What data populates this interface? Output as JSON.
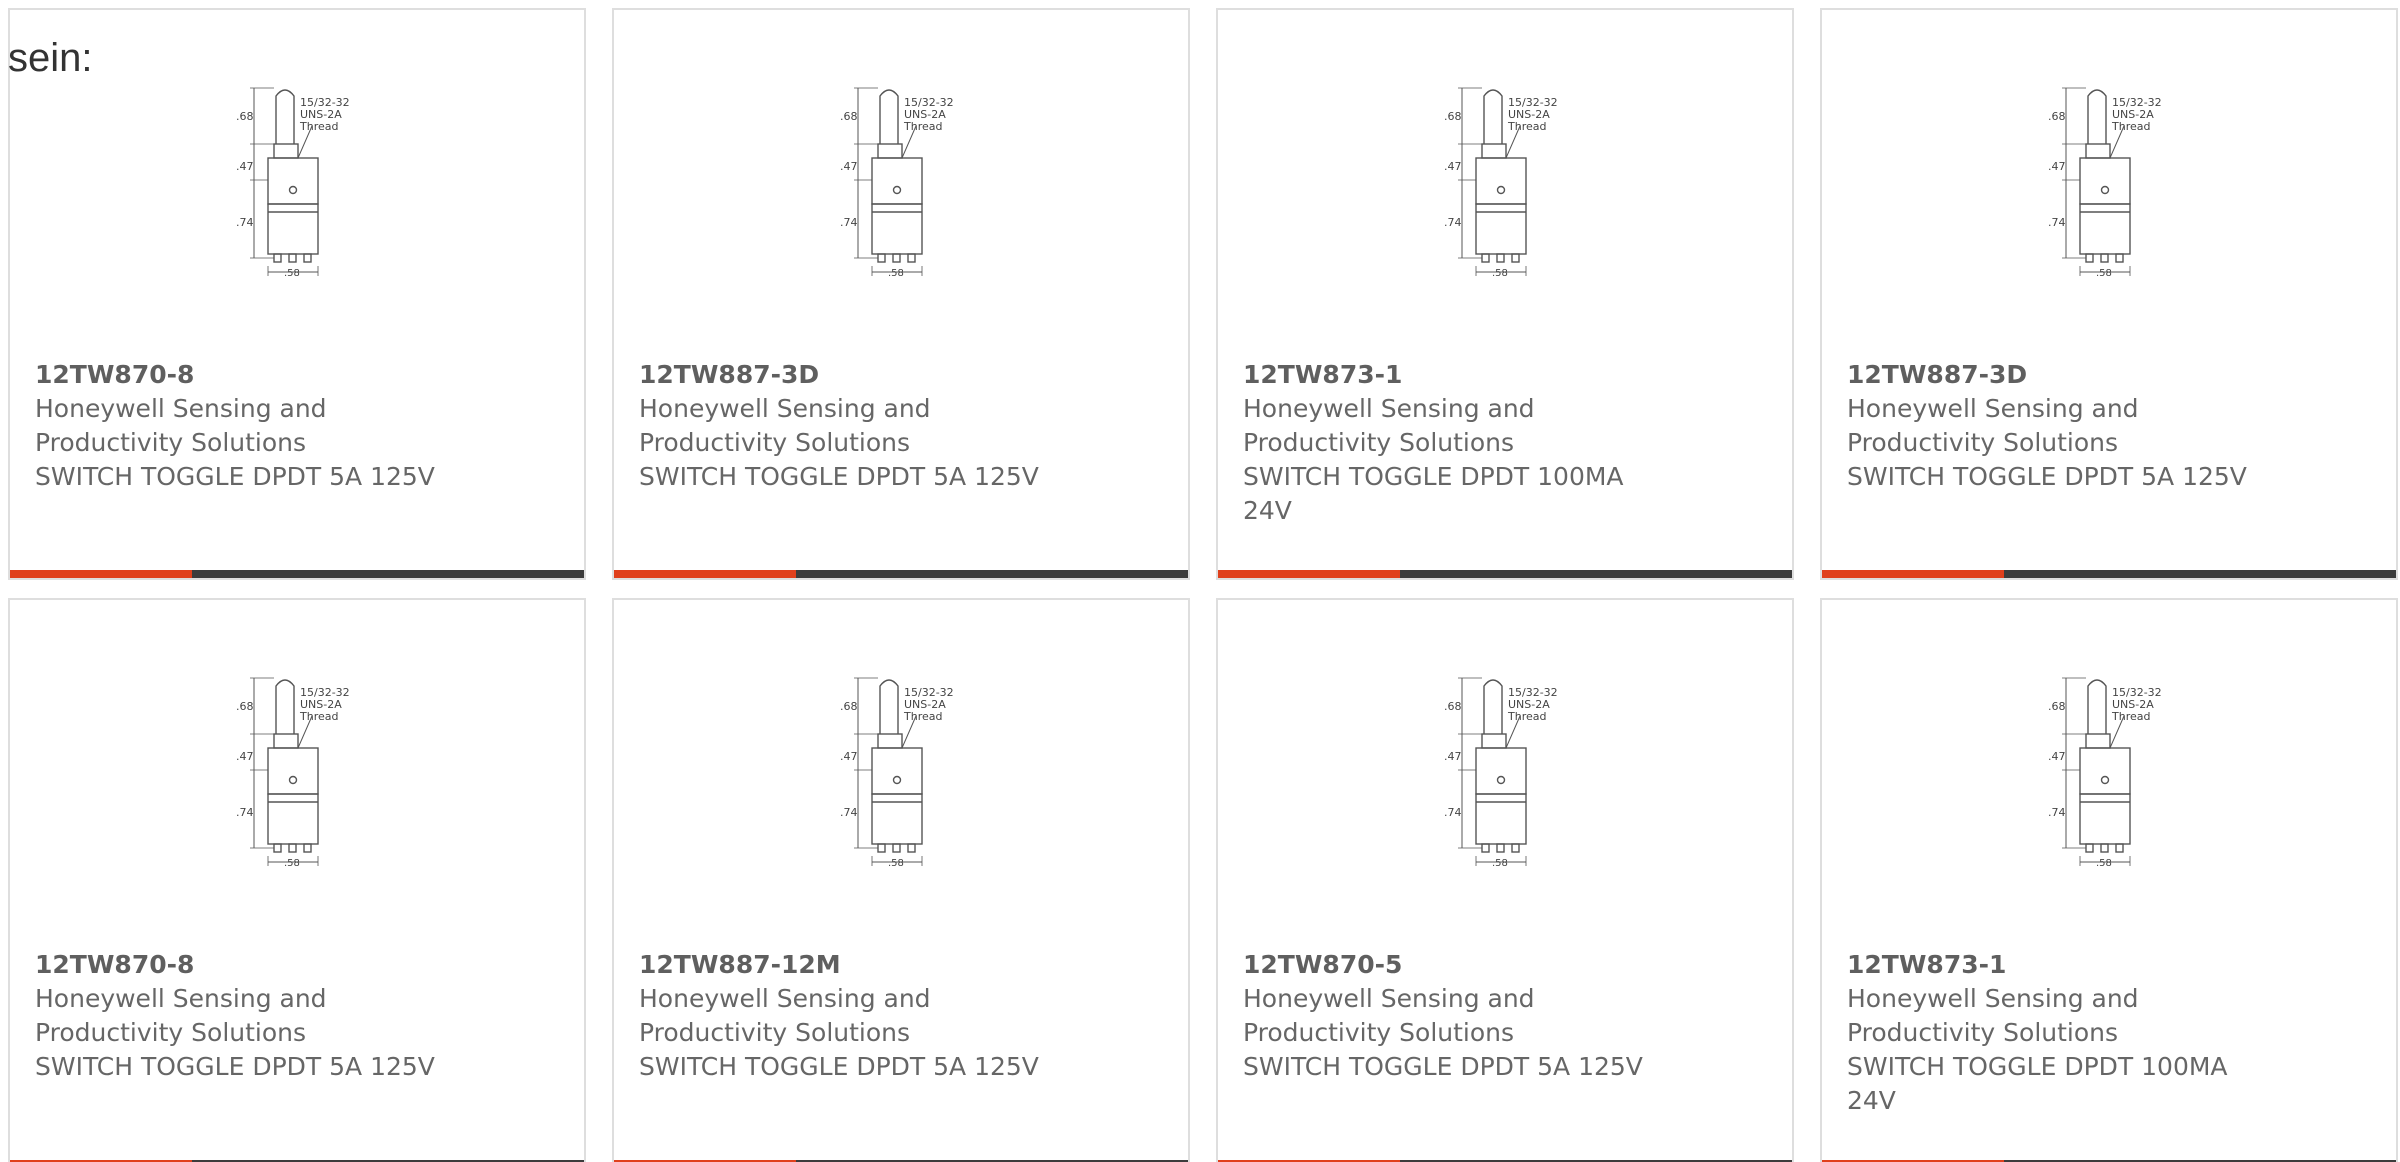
{
  "intro_text": "sein:",
  "colors": {
    "accent": "#e0401c",
    "bar": "#3c3c3c",
    "text": "#666666",
    "border": "#dedede"
  },
  "drawing": {
    "icon": "toggle-switch-dimension-drawing",
    "dim_top": ".68",
    "dim_mid": ".47",
    "dim_bottom": ".74",
    "dim_width": ".58",
    "thread_line1": "15/32-32",
    "thread_line2": "UNS-2A",
    "thread_line3": "Thread"
  },
  "products": [
    {
      "part_number": "12TW870-8",
      "manufacturer": "Honeywell Sensing and Productivity Solutions",
      "description": "SWITCH TOGGLE DPDT 5A 125V"
    },
    {
      "part_number": "12TW887-3D",
      "manufacturer": "Honeywell Sensing and Productivity Solutions",
      "description": "SWITCH TOGGLE DPDT 5A 125V"
    },
    {
      "part_number": "12TW873-1",
      "manufacturer": "Honeywell Sensing and Productivity Solutions",
      "description": "SWITCH TOGGLE DPDT 100MA 24V"
    },
    {
      "part_number": "12TW887-3D",
      "manufacturer": "Honeywell Sensing and Productivity Solutions",
      "description": "SWITCH TOGGLE DPDT 5A 125V"
    },
    {
      "part_number": "12TW870-8",
      "manufacturer": "Honeywell Sensing and Productivity Solutions",
      "description": "SWITCH TOGGLE DPDT 5A 125V"
    },
    {
      "part_number": "12TW887-12M",
      "manufacturer": "Honeywell Sensing and Productivity Solutions",
      "description": "SWITCH TOGGLE DPDT 5A 125V"
    },
    {
      "part_number": "12TW870-5",
      "manufacturer": "Honeywell Sensing and Productivity Solutions",
      "description": "SWITCH TOGGLE DPDT 5A 125V"
    },
    {
      "part_number": "12TW873-1",
      "manufacturer": "Honeywell Sensing and Productivity Solutions",
      "description": "SWITCH TOGGLE DPDT 100MA 24V"
    }
  ]
}
